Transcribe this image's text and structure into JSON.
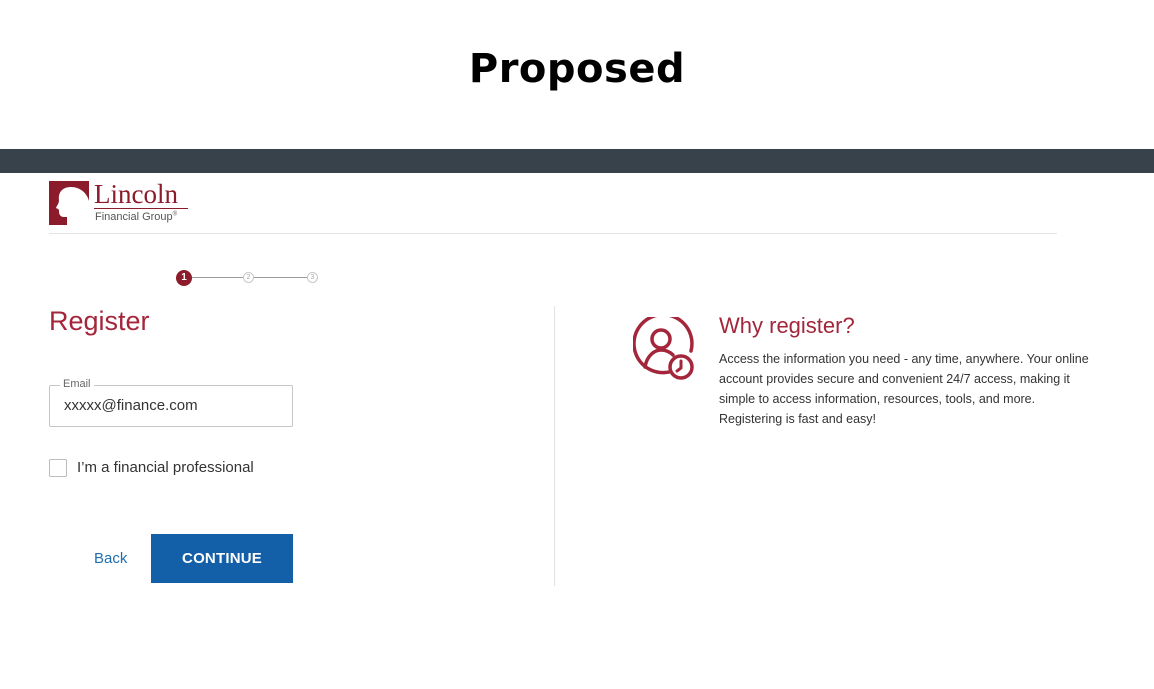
{
  "page": {
    "heading": "Proposed"
  },
  "logo": {
    "name": "Lincoln",
    "sub": "Financial Group",
    "sub_mark": "®"
  },
  "stepper": {
    "steps": [
      "1",
      "2",
      "3"
    ],
    "current": 1
  },
  "form": {
    "title": "Register",
    "email_label": "Email",
    "email_value": "xxxxx@finance.com",
    "checkbox_label": "I’m a financial professional",
    "checkbox_checked": false,
    "back_label": "Back",
    "continue_label": "CONTINUE"
  },
  "why": {
    "title": "Why register?",
    "text": "Access the information you need - any time, anywhere. Your online account provides secure and convenient 24/7 access, making it simple to access information, resources, tools, and more. Registering is fast and easy!",
    "icon": "user-clock-icon"
  },
  "colors": {
    "brand": "#8c1c2c",
    "title_red": "#a3263a",
    "primary_button": "#1460a8",
    "link": "#1f6fb0",
    "topbar": "#38424b"
  }
}
